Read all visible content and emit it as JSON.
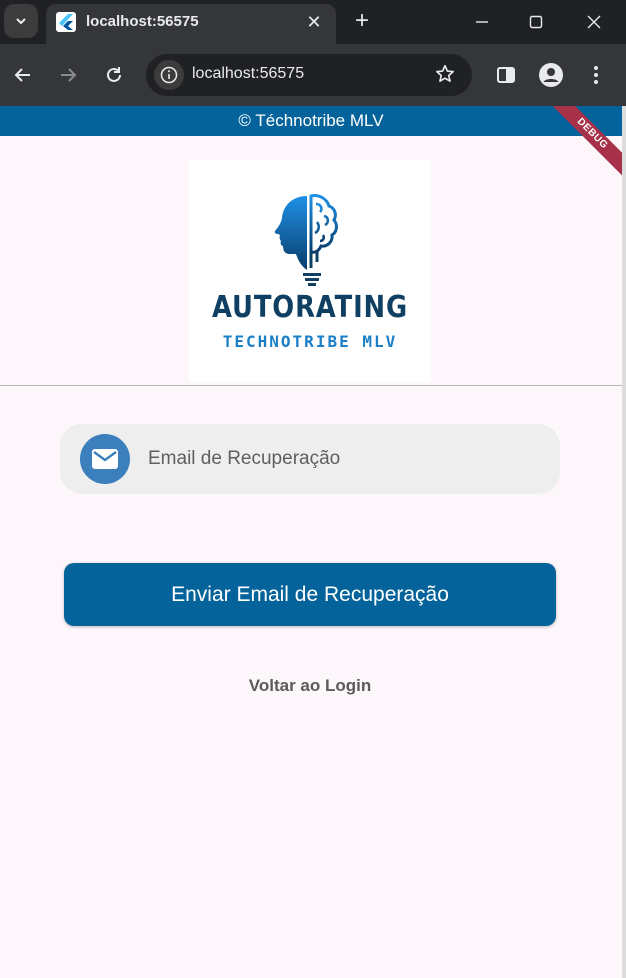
{
  "browser": {
    "tab_title": "localhost:56575",
    "url": "localhost:56575"
  },
  "page": {
    "copyright": "© Téchnotribe MLV",
    "debug_label": "DEBUG",
    "logo": {
      "name": "AUTORATING",
      "subtitle": "TECHNOTRIBE MLV"
    },
    "email_field": {
      "placeholder": "Email de Recuperação",
      "value": ""
    },
    "send_button": "Enviar Email de Recuperação",
    "back_link": "Voltar ao Login"
  },
  "colors": {
    "primary": "#04639a",
    "accent_icon": "#3b7fbd",
    "background": "#fdf7fb",
    "debug_ribbon": "#a8314a"
  },
  "icons": [
    "tab-search-icon",
    "flutter-favicon",
    "close-icon",
    "plus-icon",
    "minimize-icon",
    "maximize-icon",
    "window-close-icon",
    "back-icon",
    "forward-icon",
    "reload-icon",
    "site-info-icon",
    "star-icon",
    "side-panel-icon",
    "profile-icon",
    "menu-icon",
    "mail-icon"
  ]
}
